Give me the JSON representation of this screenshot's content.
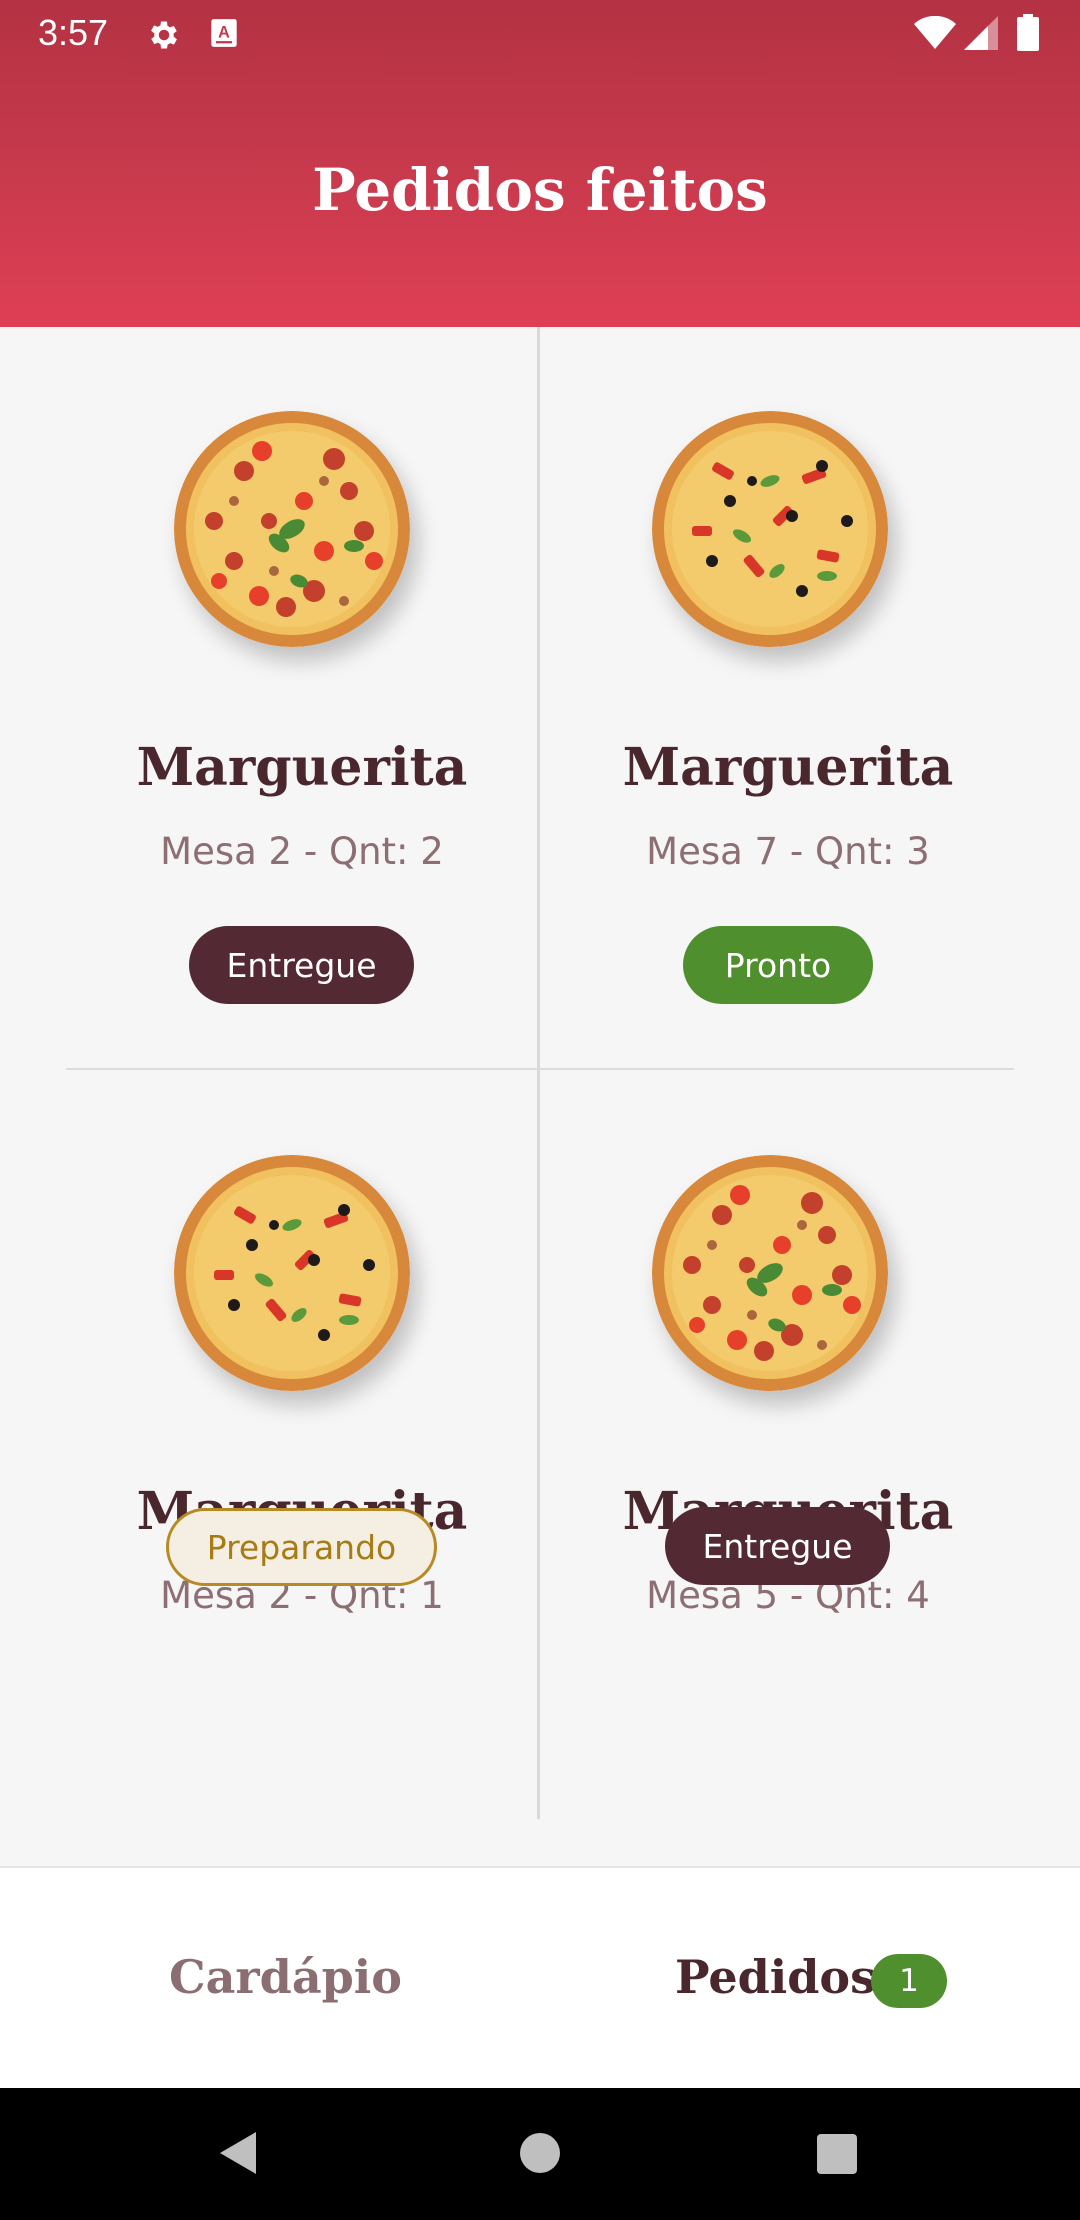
{
  "status_bar": {
    "time": "3:57",
    "icons": [
      "gear-icon",
      "a-text-icon",
      "wifi-icon",
      "signal-icon",
      "battery-icon"
    ]
  },
  "header": {
    "title": "Pedidos feitos",
    "gradient": [
      "#b33243",
      "#df3f54"
    ]
  },
  "orders": [
    {
      "name": "Marguerita",
      "meta": "Mesa 2 - Qnt: 2",
      "status": "Entregue",
      "image": "pizza-tomato-basil"
    },
    {
      "name": "Marguerita",
      "meta": "Mesa 7 - Qnt: 3",
      "status": "Pronto",
      "image": "pizza-olive-pepper"
    },
    {
      "name": "Marguerita",
      "meta": "Mesa 2 - Qnt: 1",
      "status": "Preparando",
      "image": "pizza-olive-pepper"
    },
    {
      "name": "Marguerita",
      "meta": "Mesa 5 - Qnt: 4",
      "status": "Entregue",
      "image": "pizza-tomato-basil"
    }
  ],
  "status_colors": {
    "Entregue": "#532a33",
    "Pronto": "#4f8f2d",
    "Preparando": "#b78a23"
  },
  "bottom_nav": {
    "items": [
      {
        "label": "Cardápio",
        "active": false
      },
      {
        "label": "Pedidos",
        "active": true,
        "badge": "1"
      }
    ]
  },
  "system_nav": [
    "back-icon",
    "home-icon",
    "recents-icon"
  ]
}
